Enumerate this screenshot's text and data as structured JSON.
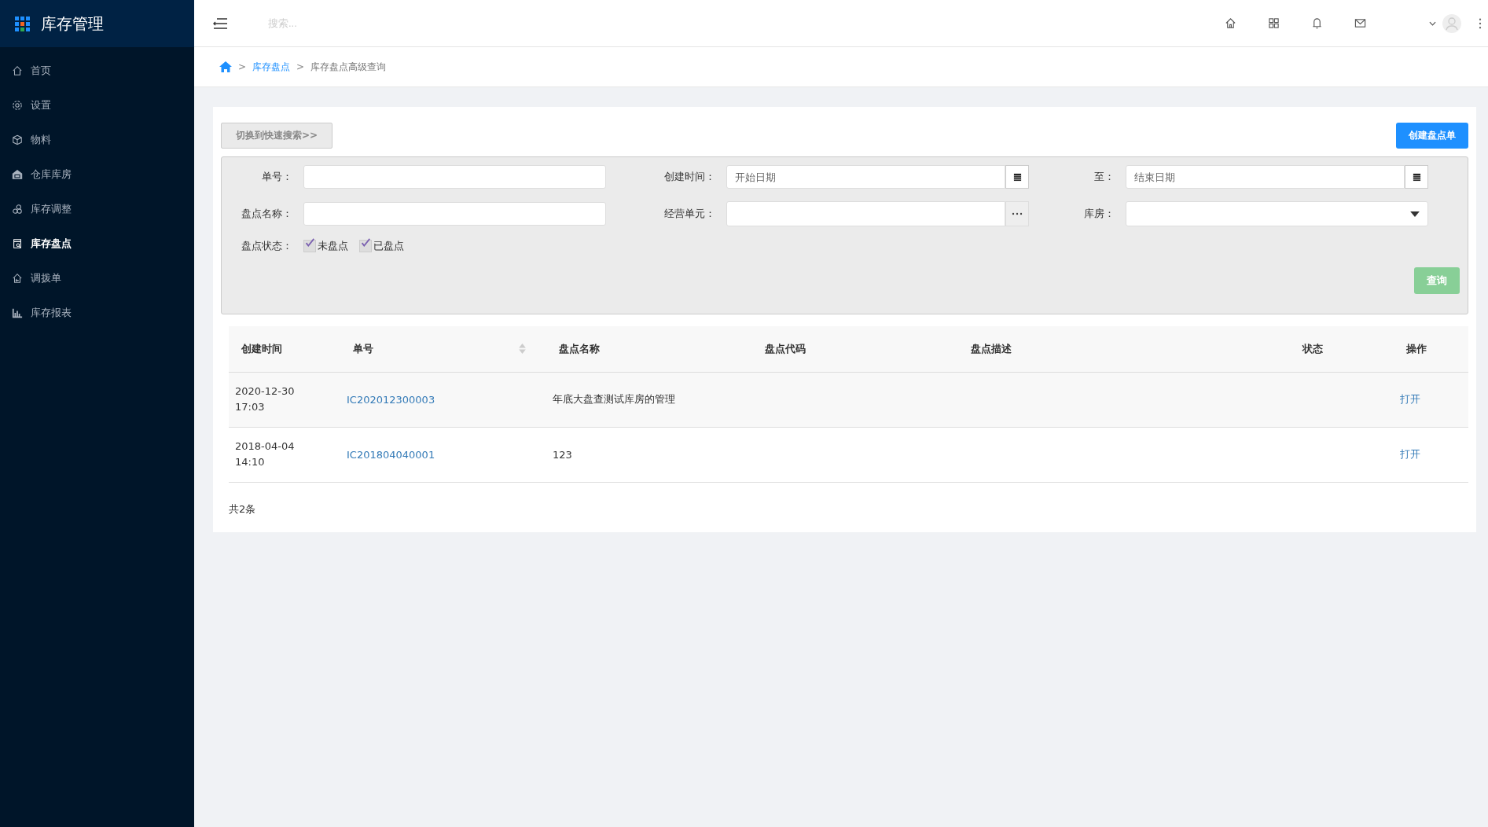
{
  "app": {
    "title": "库存管理"
  },
  "sidebar": {
    "items": [
      {
        "label": "首页",
        "selected": false
      },
      {
        "label": "设置",
        "selected": false
      },
      {
        "label": "物料",
        "selected": false
      },
      {
        "label": "仓库库房",
        "selected": false
      },
      {
        "label": "库存调整",
        "selected": false
      },
      {
        "label": "库存盘点",
        "selected": true
      },
      {
        "label": "调拨单",
        "selected": false
      },
      {
        "label": "库存报表",
        "selected": false
      }
    ]
  },
  "topbar": {
    "search_placeholder": "搜索..."
  },
  "breadcrumb": {
    "separator": ">",
    "items": [
      "库存盘点",
      "库存盘点高级查询"
    ]
  },
  "toolbar": {
    "switch_button": "切换到快速搜索>>",
    "create_button": "创建盘点单"
  },
  "filters": {
    "number": {
      "label": "单号："
    },
    "created": {
      "label": "创建时间：",
      "placeholder": "开始日期"
    },
    "to": {
      "label": "至：",
      "placeholder": "结束日期"
    },
    "name": {
      "label": "盘点名称："
    },
    "unit": {
      "label": "经营单元："
    },
    "room": {
      "label": "库房："
    },
    "status": {
      "label": "盘点状态：",
      "options": [
        {
          "label": "未盘点",
          "checked": true
        },
        {
          "label": "已盘点",
          "checked": true
        }
      ]
    },
    "query_button": "查询"
  },
  "table": {
    "columns": [
      "创建时间",
      "单号",
      "盘点名称",
      "盘点代码",
      "盘点描述",
      "状态",
      "操作"
    ],
    "rows": [
      {
        "created": "2020-12-30 17:03",
        "number": "IC202012300003",
        "name": "年底大盘查测试库房的管理",
        "action": "打开"
      },
      {
        "created": "2018-04-04 14:10",
        "number": "IC201804040001",
        "name": "123",
        "action": "打开"
      }
    ],
    "total": "共2条"
  }
}
